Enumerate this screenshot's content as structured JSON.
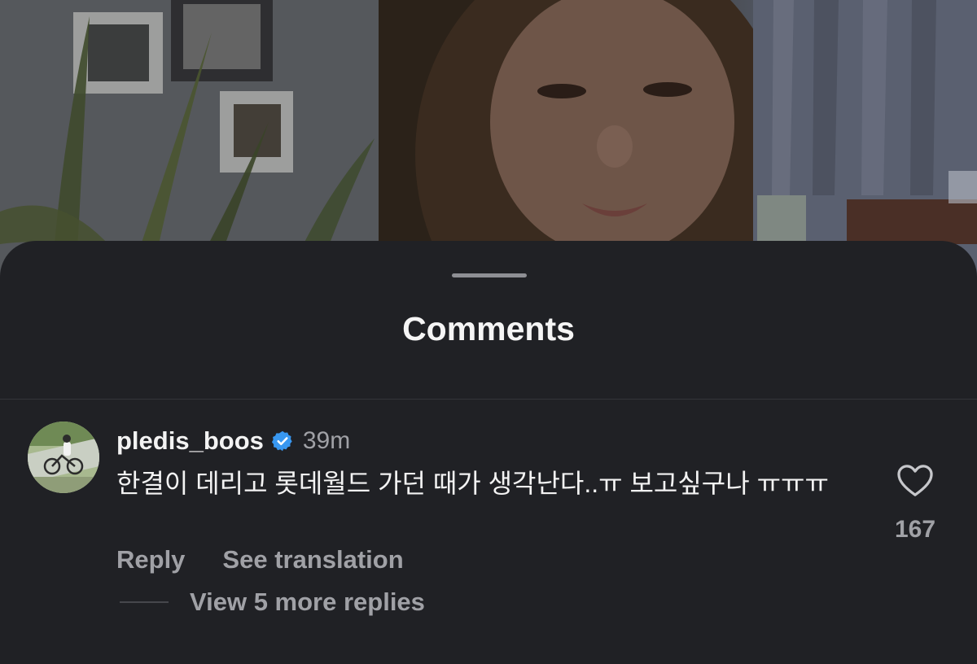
{
  "sheet": {
    "title": "Comments"
  },
  "comment": {
    "username": "pledis_boos",
    "verified_icon": "verified-badge-icon",
    "time": "39m",
    "text": "한결이 데리고 롯데월드 가던 때가 생각난다..ㅠ 보고싶구나 ㅠㅠㅠ",
    "reply_label": "Reply",
    "translate_label": "See translation",
    "view_replies_label": "View 5 more replies",
    "like_icon": "heart-icon",
    "like_count": "167"
  },
  "colors": {
    "sheet_background": "#202125",
    "primary_text": "#f3f3f3",
    "secondary_text": "#a0a1a6",
    "verified_badge": "#3897f0"
  }
}
